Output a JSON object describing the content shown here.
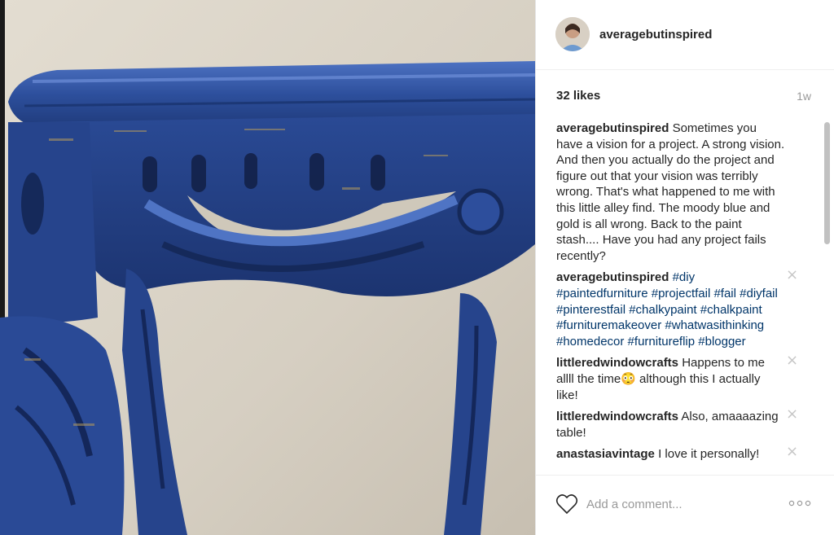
{
  "post": {
    "username": "averagebutinspired",
    "likes": "32 likes",
    "time_ago": "1w"
  },
  "comments": [
    {
      "user": "averagebutinspired",
      "text": "Sometimes you have a vision for a project. A strong vision. And then you actually do the project and figure out that your vision was terribly wrong. That's what happened to me with this little alley find. The moody blue and gold is all wrong. Back to the paint stash.... Have you had any project fails recently?"
    },
    {
      "user": "averagebutinspired",
      "text": "#diy #paintedfurniture #projectfail #fail #diyfail #pinterestfail #chalkypaint #chalkpaint #furnituremakeover #whatwasithinking #homedecor #furnitureflip #blogger",
      "close": "×"
    },
    {
      "user": "littleredwindowcrafts",
      "text": "Happens to me allll the time😳 although this I actually like!",
      "close": "×"
    },
    {
      "user": "littleredwindowcrafts",
      "text": "Also, amaaaazing table!",
      "close": "×"
    },
    {
      "user": "anastasiavintage",
      "text": "I love it personally!",
      "close": "×"
    }
  ],
  "footer": {
    "comment_placeholder": "Add a comment..."
  },
  "icons": {
    "like": "heart-icon",
    "more": "more-options-icon",
    "remove": "close-icon"
  },
  "colors": {
    "hashtag": "#003569",
    "furniture_blue": "#3558a8",
    "wall": "#d8d2c6"
  }
}
